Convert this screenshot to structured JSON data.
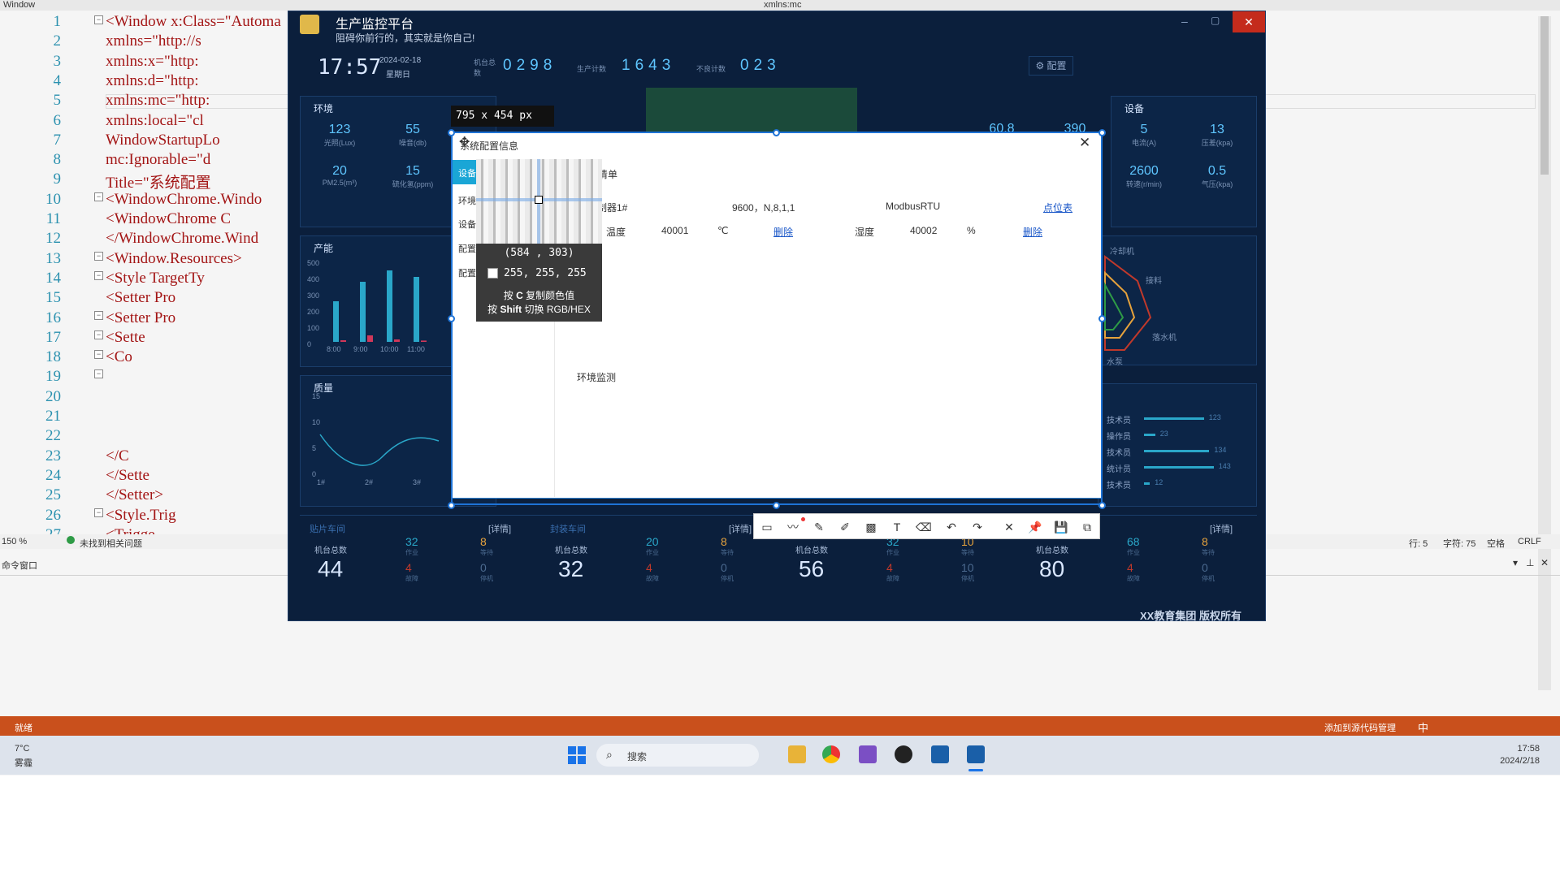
{
  "editor": {
    "window_title": "Window",
    "tab_title": "xmlns:mc",
    "line_numbers": [
      "1",
      "2",
      "3",
      "4",
      "5",
      "6",
      "7",
      "8",
      "9",
      "10",
      "11",
      "12",
      "13",
      "14",
      "15",
      "16",
      "17",
      "18",
      "19",
      "20",
      "21",
      "22",
      "23",
      "24",
      "25",
      "26",
      "27"
    ],
    "lines": [
      "<Window x:Class=\"Automa",
      "    xmlns=\"http://s",
      "    xmlns:x=\"http:",
      "    xmlns:d=\"http:",
      "    xmlns:mc=\"http:",
      "    xmlns:local=\"cl",
      "    WindowStartupLo",
      "    mc:Ignorable=\"d",
      "    Title=\"系统配置",
      "  <WindowChrome.Windo",
      "    <WindowChrome C",
      "  </WindowChrome.Wind",
      "  <Window.Resources>",
      "    <Style TargetTy",
      "      <Setter Pro",
      "      <Setter Pro",
      "        <Sette",
      "          <Co",
      "",
      "",
      "",
      "",
      "          </C",
      "        </Sette",
      "      </Setter>",
      "    <Style.Trig",
      "      <Trigge"
    ],
    "zoom": "150 %",
    "no_issues": "未找到相关问题",
    "row": "行: 5",
    "char": "字符: 75",
    "space": "空格",
    "crlf": "CRLF",
    "cmd_window": "命令窗口",
    "status_ready": "就绪",
    "source_control": "添加到源代码管理",
    "ime": "中"
  },
  "taskbar": {
    "weather_temp": "7°C",
    "weather_desc": "雾霾",
    "search_placeholder": "搜索",
    "time": "17:58",
    "date": "2024/2/18"
  },
  "app": {
    "title": "生产监控平台",
    "subtitle": "阻碍你前行的，其实就是你自己!",
    "clock": "17:57",
    "date": "2024-02-18",
    "weekday": "星期日",
    "machine_total_label": "机台总数",
    "machine_total_value": "0298",
    "production_label": "生产计数",
    "production_value": "1643",
    "defect_label": "不良计数",
    "defect_value": "023",
    "config_button": "配置",
    "env_title": "环境",
    "env_stats": [
      {
        "value": "123",
        "label": "光照(Lux)"
      },
      {
        "value": "55",
        "label": "噪音(db)"
      },
      {
        "value": "20",
        "label": "PM2.5(m³)"
      },
      {
        "value": "15",
        "label": "硫化氢(ppm)"
      }
    ],
    "device_title": "设备",
    "device_stats": [
      {
        "value": "60.8",
        "label": ""
      },
      {
        "value": "390",
        "label": ""
      },
      {
        "value": "5",
        "label": "电流(A)"
      },
      {
        "value": "13",
        "label": "压差(kpa)"
      },
      {
        "value": "2600",
        "label": "转速(r/min)"
      },
      {
        "value": "0.5",
        "label": "气压(kpa)"
      }
    ],
    "capacity_title": "产能",
    "quality_title": "质量",
    "radar_labels": [
      "冷却机",
      "接料",
      "落水机",
      "水泵"
    ],
    "staff": [
      {
        "role": "技术员",
        "value": "123"
      },
      {
        "role": "操作员",
        "value": "23"
      },
      {
        "role": "技术员",
        "value": "134"
      },
      {
        "role": "统计员",
        "value": "143"
      },
      {
        "role": "技术员",
        "value": "12"
      }
    ],
    "workshops": [
      {
        "name": "贴片车间",
        "detail": "[详情]",
        "total": "44",
        "work": "32",
        "wait": "8",
        "fault": "4",
        "stop": "0"
      },
      {
        "name": "封装车间",
        "detail": "[详情]",
        "total": "32",
        "work": "20",
        "wait": "8",
        "fault": "4",
        "stop": "0"
      },
      {
        "name": "",
        "detail": "",
        "total": "56",
        "work": "32",
        "wait": "10",
        "fault": "4",
        "stop": "10"
      },
      {
        "name": "",
        "detail": "[详情]",
        "total": "80",
        "work": "68",
        "wait": "8",
        "fault": "4",
        "stop": "0"
      }
    ],
    "ws_labels": {
      "total": "机台总数",
      "work": "作业",
      "wait": "等待",
      "fault": "故障",
      "stop": "停机"
    },
    "copyright": "XX教育集团 版权所有"
  },
  "capacity_chart": {
    "type": "bar",
    "categories": [
      "8:00",
      "9:00",
      "10:00",
      "11:00"
    ],
    "series": [
      {
        "values": [
          250,
          370,
          440,
          400
        ],
        "color": "#2aa7c9"
      },
      {
        "values": [
          10,
          40,
          15,
          8
        ],
        "color": "#d0385a"
      }
    ],
    "yticks": [
      "500",
      "400",
      "300",
      "200",
      "100",
      "0"
    ],
    "ylim": [
      0,
      500
    ]
  },
  "quality_chart": {
    "type": "line",
    "categories": [
      "1#",
      "2#",
      "3#"
    ],
    "yticks": [
      "15",
      "10",
      "5",
      "0"
    ],
    "ylim": [
      0,
      15
    ]
  },
  "dialog": {
    "title": "系统配置信息",
    "size_label": "795 x 454 px",
    "tabs": [
      "设备",
      "环境",
      "设备",
      "配置",
      "配置"
    ],
    "section_label": "清单",
    "device_row": {
      "name": "控制器1#",
      "params": "9600，N,8,1,1",
      "protocol": "ModbusRTU",
      "link": "点位表"
    },
    "point_row": [
      {
        "name": "温度",
        "addr": "40001",
        "unit": "℃",
        "action": "删除"
      },
      {
        "name": "湿度",
        "addr": "40002",
        "unit": "%",
        "action": "删除"
      }
    ],
    "env_label": "环境监测"
  },
  "magnifier": {
    "coords": "(584 , 303)",
    "rgb": "255, 255, 255",
    "copy_hint_pre": "按",
    "copy_key": "C",
    "copy_hint_post": "复制颜色值",
    "switch_hint_pre": "按",
    "switch_key": "Shift",
    "switch_hint_post": "切换 RGB/HEX"
  },
  "colors": {
    "app_bg": "#0b1f3c",
    "accent": "#5fc6ff",
    "selection": "#1e73d6",
    "status_bar": "#c9501c",
    "dialog_tab_active": "#1aa6d6"
  }
}
